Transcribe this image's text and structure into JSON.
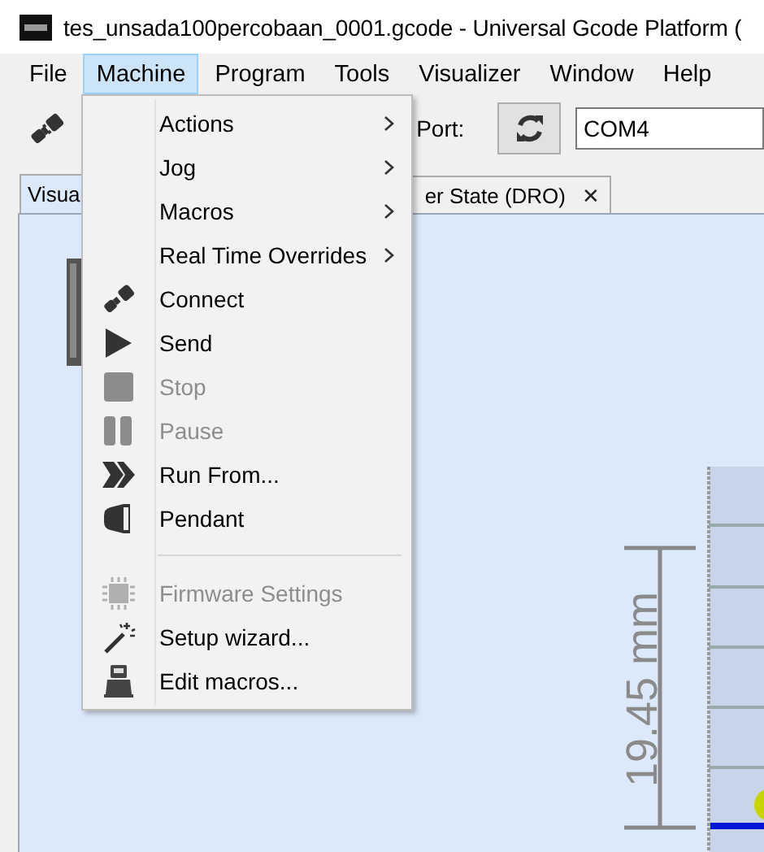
{
  "window": {
    "title": "tes_unsada100percobaan_0001.gcode - Universal Gcode Platform ("
  },
  "menu_bar": [
    {
      "label": "File",
      "selected": false
    },
    {
      "label": "Machine",
      "selected": true
    },
    {
      "label": "Program",
      "selected": false
    },
    {
      "label": "Tools",
      "selected": false
    },
    {
      "label": "Visualizer",
      "selected": false
    },
    {
      "label": "Window",
      "selected": false
    },
    {
      "label": "Help",
      "selected": false
    }
  ],
  "toolbar": {
    "port_label": "Port:",
    "port_value": "COM4"
  },
  "tabs": [
    {
      "label": "Visua",
      "selected": true
    },
    {
      "label": "er State (DRO)",
      "selected": false,
      "close_glyph": "✕"
    }
  ],
  "open_menu": {
    "items": [
      {
        "kind": "submenu",
        "label": "Actions",
        "disabled": false
      },
      {
        "kind": "submenu",
        "label": "Jog",
        "disabled": false
      },
      {
        "kind": "submenu",
        "label": "Macros",
        "disabled": false
      },
      {
        "kind": "submenu",
        "label": "Real Time Overrides",
        "disabled": false
      },
      {
        "kind": "command",
        "label": "Connect",
        "disabled": false
      },
      {
        "kind": "command",
        "label": "Send",
        "disabled": false
      },
      {
        "kind": "command",
        "label": "Stop",
        "disabled": true
      },
      {
        "kind": "command",
        "label": "Pause",
        "disabled": true
      },
      {
        "kind": "command",
        "label": "Run From...",
        "disabled": false
      },
      {
        "kind": "command",
        "label": "Pendant",
        "disabled": false
      },
      {
        "kind": "separator"
      },
      {
        "kind": "command",
        "label": "Firmware Settings",
        "disabled": true
      },
      {
        "kind": "command",
        "label": "Setup wizard...",
        "disabled": false
      },
      {
        "kind": "command",
        "label": "Edit macros...",
        "disabled": false
      }
    ]
  },
  "visualizer": {
    "dimension_label": "19.45 mm"
  }
}
